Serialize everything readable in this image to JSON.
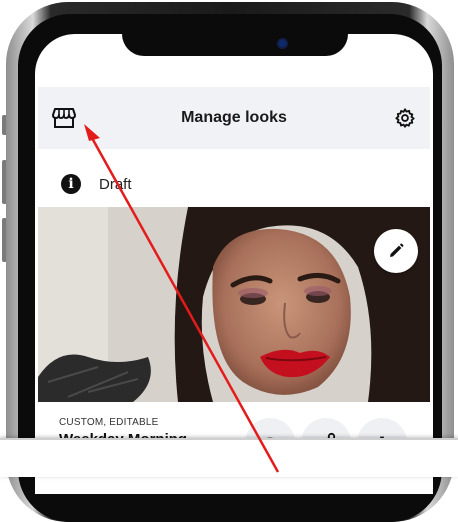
{
  "header": {
    "title": "Manage looks",
    "left_icon": "store-icon",
    "right_icon": "gear-icon"
  },
  "status": {
    "icon": "info-icon",
    "glyph": "i",
    "label": "Draft"
  },
  "look": {
    "tags": "CUSTOM, EDITABLE",
    "name": "Weekday Morning Routine",
    "edit_icon": "pencil-icon",
    "actions": [
      {
        "name": "eye-icon"
      },
      {
        "name": "share-icon"
      },
      {
        "name": "bar-chart-icon"
      }
    ]
  },
  "annotation": {
    "arrow_color": "#e41b1b"
  }
}
